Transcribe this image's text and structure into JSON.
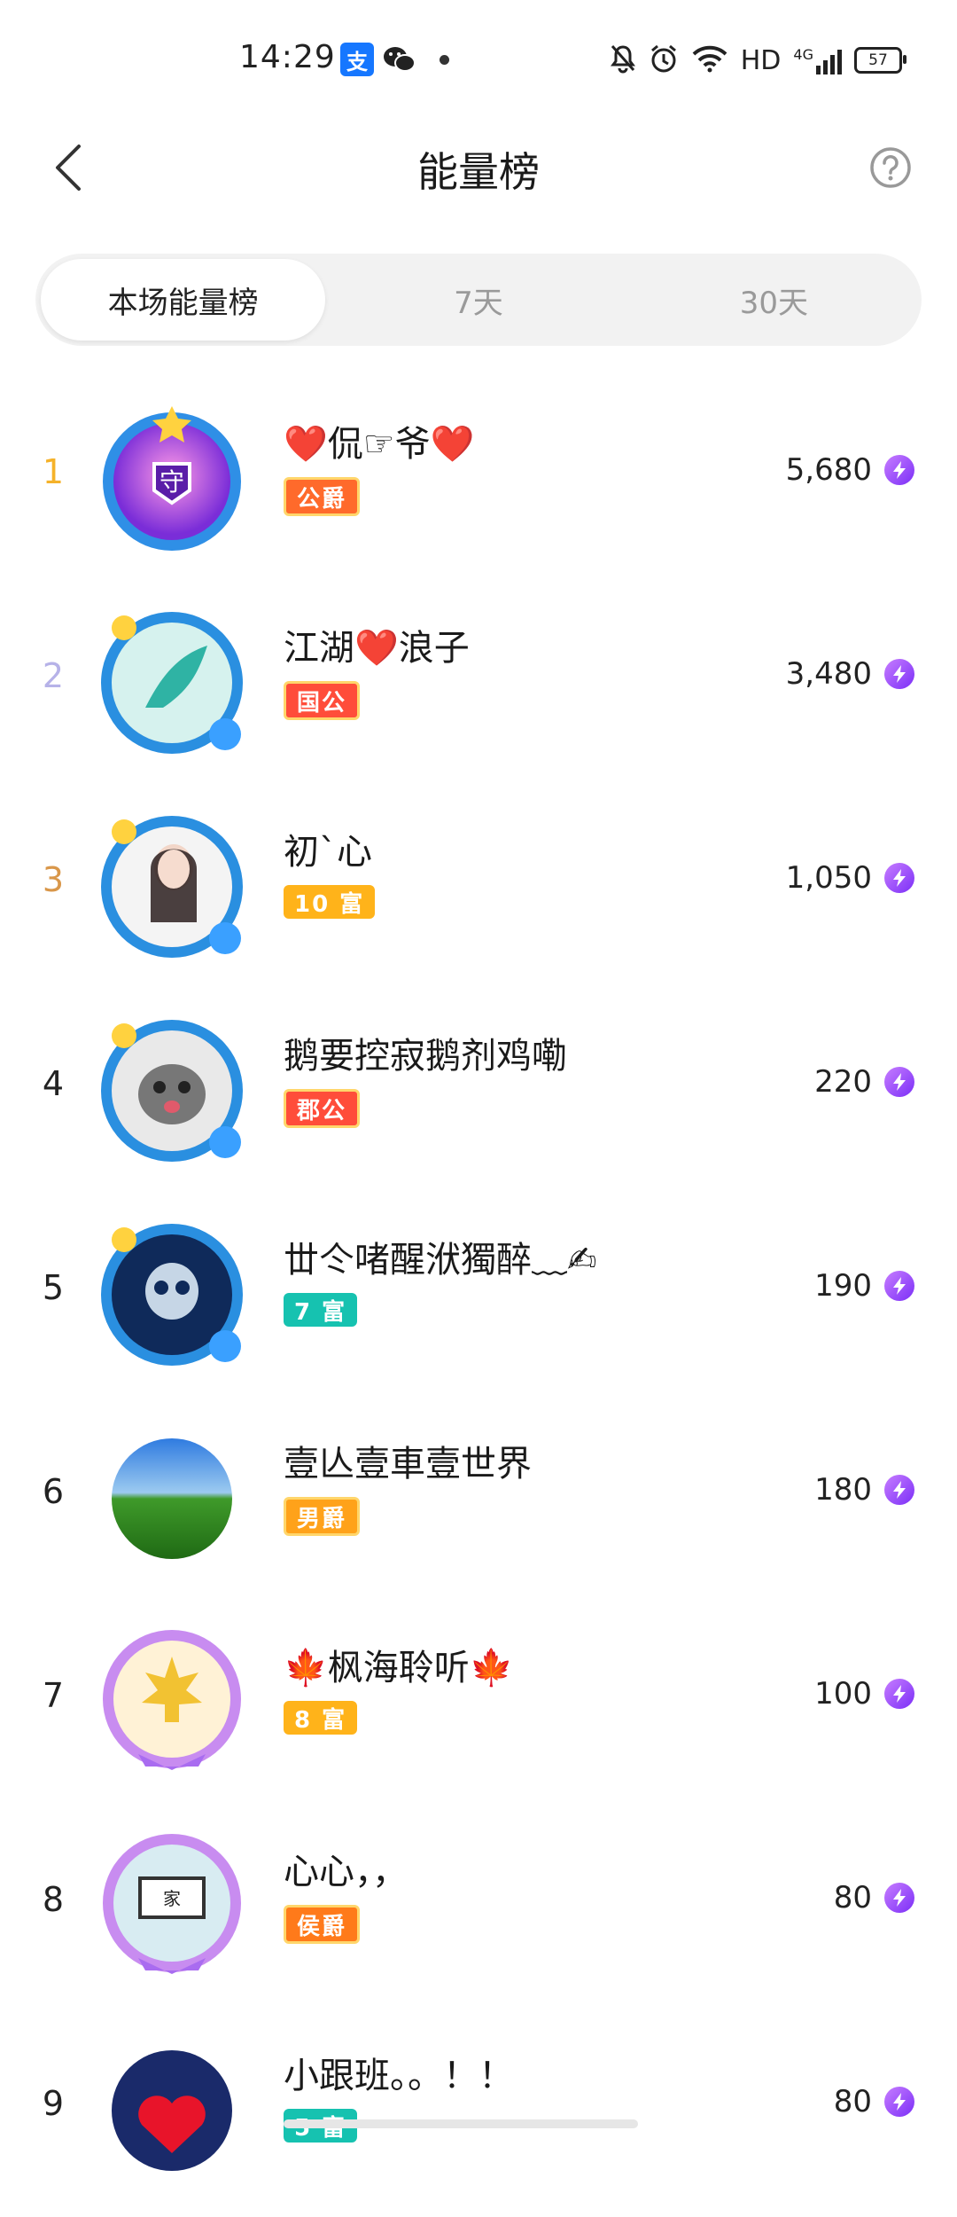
{
  "status_bar": {
    "time": "14:29",
    "alipay_glyph": "支",
    "network": "HD",
    "signal": "4G",
    "battery": "57",
    "icons": [
      "alipay-icon",
      "wechat-icon",
      "notification-dot",
      "mute-bell-icon",
      "alarm-icon",
      "wifi-icon",
      "signal-icon",
      "battery-icon"
    ]
  },
  "header": {
    "title": "能量榜",
    "back_icon": "chevron-left-icon",
    "help_icon": "question-circle-icon"
  },
  "tabs": [
    {
      "label": "本场能量榜",
      "active": true
    },
    {
      "label": "7天",
      "active": false
    },
    {
      "label": "30天",
      "active": false
    }
  ],
  "rank_colors": {
    "1": "#f5b22a",
    "2": "#b6b2e8",
    "3": "#d9974a",
    "default": "#222222"
  },
  "ranking": [
    {
      "rank": "1",
      "name": "❤️侃☞爷❤️",
      "badge": "公爵",
      "badge_color": "#ff6a2b",
      "energy": "5,680",
      "avatar": "frame-guardian"
    },
    {
      "rank": "2",
      "name": "江湖❤️浪子",
      "badge": "国公",
      "badge_color": "#ff4d3a",
      "energy": "3,480",
      "avatar": "frame-blue-dragon"
    },
    {
      "rank": "3",
      "name": "初`心",
      "badge": "10 富",
      "badge_color": "#ffb31a",
      "energy": "1,050",
      "avatar": "frame-blue-girl"
    },
    {
      "rank": "4",
      "name": "鹅要控寂鹅剂鸡嘞",
      "badge": "郡公",
      "badge_color": "#ff4d3a",
      "energy": "220",
      "avatar": "frame-blue-cat"
    },
    {
      "rank": "5",
      "name": "丗仒啫醒洑獨醉﹏✍",
      "badge": "7 富",
      "badge_color": "#16c2b0",
      "energy": "190",
      "avatar": "frame-blue-skull"
    },
    {
      "rank": "6",
      "name": "壹亾壹車壹世界",
      "badge": "男爵",
      "badge_color": "#ffa21a",
      "energy": "180",
      "avatar": "plain-green-field"
    },
    {
      "rank": "7",
      "name": "🍁枫海聆听🍁",
      "badge": "8 富",
      "badge_color": "#ffb31a",
      "energy": "100",
      "avatar": "frame-purple-leaf"
    },
    {
      "rank": "8",
      "name": "心心，，",
      "badge": "侯爵",
      "badge_color": "#ff7a1a",
      "energy": "80",
      "avatar": "frame-purple-calligraphy"
    },
    {
      "rank": "9",
      "name": "小跟班。。！！",
      "badge": "5 富",
      "badge_color": "#16c2b0",
      "energy": "80",
      "avatar": "plain-heart"
    }
  ]
}
